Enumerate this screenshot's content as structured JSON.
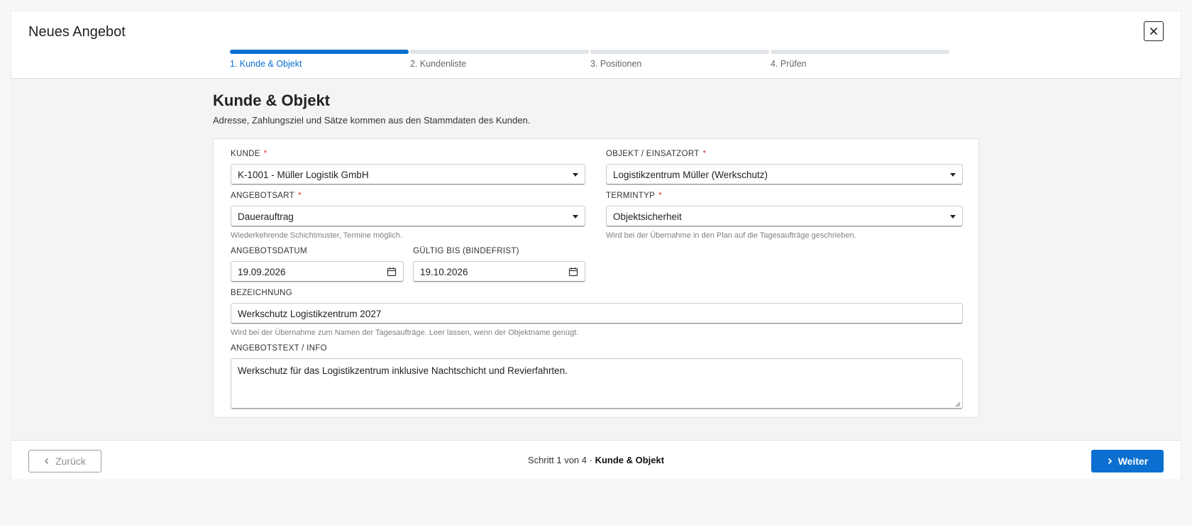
{
  "modal": {
    "title": "Neues Angebot",
    "close_label": "×"
  },
  "steps": [
    {
      "label": "1. Kunde & Objekt",
      "active": true
    },
    {
      "label": "2. Kundenliste",
      "active": false
    },
    {
      "label": "3. Positionen",
      "active": false
    },
    {
      "label": "4. Prüfen",
      "active": false
    }
  ],
  "section": {
    "title": "Kunde & Objekt",
    "subtitle": "Adresse, Zahlungsziel und Sätze kommen aus den Stammdaten des Kunden."
  },
  "form": {
    "kunde": {
      "label": "Kunde",
      "required": "*",
      "value": "K-1001 - Müller Logistik GmbH"
    },
    "objekt": {
      "label": "Objekt / Einsatzort",
      "required": "*",
      "value": "Logistikzentrum Müller (Werkschutz)"
    },
    "angebotsart": {
      "label": "Angebotsart",
      "required": "*",
      "value": "Dauerauftrag",
      "hint": "Wiederkehrende Schichtmuster, Termine möglich."
    },
    "termintyp": {
      "label": "Termintyp",
      "required": "*",
      "value": "Objektsicherheit",
      "hint": "Wird bei der Übernahme in den Plan auf die Tagesaufträge geschrieben."
    },
    "angebotsdatum": {
      "label": "Angebotsdatum",
      "value": "19.09.2026"
    },
    "gueltig_bis": {
      "label": "Gültig bis (Bindefrist)",
      "value": "19.10.2026"
    },
    "bezeichnung": {
      "label": "Bezeichnung",
      "value": "Werkschutz Logistikzentrum 2027",
      "hint": "Wird bei der Übernahme zum Namen der Tagesaufträge. Leer lassen, wenn der Objektname genügt."
    },
    "angebotstext": {
      "label": "Angebotstext / Info",
      "value": "Werkschutz für das Logistikzentrum inklusive Nachtschicht und Revierfahrten."
    }
  },
  "footer": {
    "back_label": "Zurück",
    "status_prefix": "Schritt 1 von 4 ·",
    "status_step": "Kunde & Objekt",
    "next_label": "Weiter"
  },
  "colors": {
    "accent": "#0a6fd0",
    "required": "#d6322e"
  }
}
